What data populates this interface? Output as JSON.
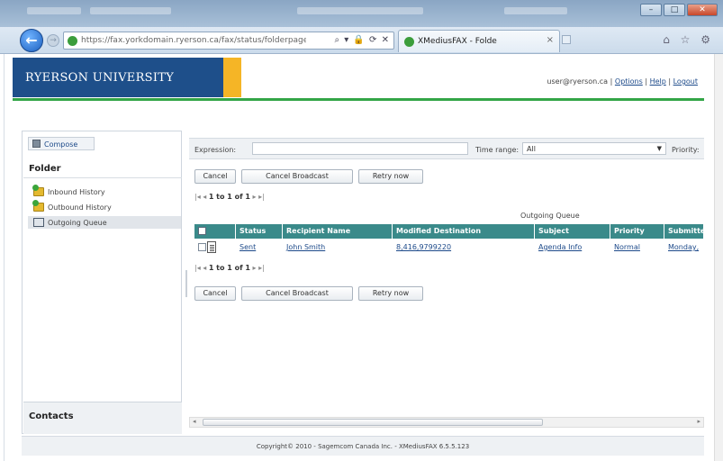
{
  "browser": {
    "address": "https://fax.yorkdomain.ryerson.ca/fax/status/folderpage",
    "address_icons": "⌕ ▾ 🔒 ⟳ ✕",
    "tab_title": "XMediusFAX - Folde",
    "tab_close": "×",
    "back": "←",
    "forward": "→",
    "toolbar_icons": "⌂ ☆ ⚙",
    "window_buttons": [
      "–",
      "□",
      "✕"
    ]
  },
  "header": {
    "brand": "RYERSON UNIVERSITY",
    "user": "user@ryerson.ca",
    "sep1": "|",
    "options": "Options",
    "sep2": "|",
    "help": "Help",
    "sep3": "|",
    "logout": "Logout"
  },
  "sidebar": {
    "compose": "Compose",
    "folder_title": "Folder",
    "items": [
      {
        "label": "Inbound History"
      },
      {
        "label": "Outbound History"
      },
      {
        "label": "Outgoing Queue"
      }
    ],
    "contacts": "Contacts"
  },
  "filters": {
    "expression_label": "Expression:",
    "time_range_label": "Time range:",
    "time_range_value": "All",
    "priority_label": "Priority:"
  },
  "actions": {
    "cancel": "Cancel",
    "cancel_broadcast": "Cancel Broadcast",
    "retry_now": "Retry now"
  },
  "pager": {
    "prev_arrows": "|◂ ◂",
    "range": "1 to 1 of 1",
    "next_arrows": "▸ ▸|"
  },
  "table": {
    "caption": "Outgoing Queue",
    "columns": [
      "Status",
      "Recipient Name",
      "Modified Destination",
      "Subject",
      "Priority",
      "Submitted"
    ],
    "rows": [
      {
        "status": "Sent",
        "recipient": "John Smith",
        "destination": "8,416,9799220",
        "subject": "Agenda Info",
        "priority": "Normal",
        "submitted": "Monday,"
      }
    ]
  },
  "footer": {
    "copyright": "Copyright© 2010 - Sagemcom Canada Inc. - XMediusFAX 6.5.5.123"
  }
}
